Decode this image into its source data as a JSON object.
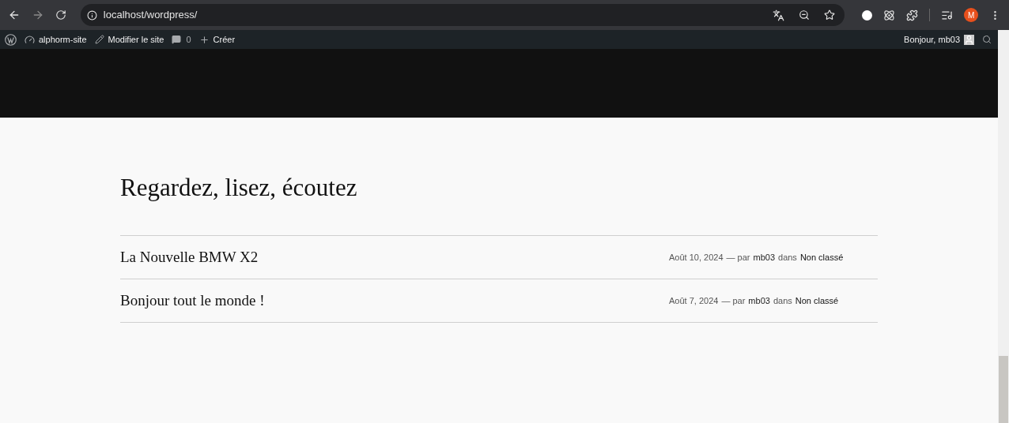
{
  "browser": {
    "url": "localhost/wordpress/",
    "profile_initial": "M"
  },
  "admin_bar": {
    "site": "alphorm-site",
    "edit": "Modifier le site",
    "comments": "0",
    "create": "Créer",
    "greeting": "Bonjour, mb03"
  },
  "section_title": "Regardez, lisez, écoutez",
  "posts": [
    {
      "title": "La Nouvelle BMW X2",
      "date": "Août 10, 2024",
      "by": "— par",
      "author": "mb03",
      "in": "dans",
      "category": "Non classé"
    },
    {
      "title": "Bonjour tout le monde !",
      "date": "Août 7, 2024",
      "by": "— par",
      "author": "mb03",
      "in": "dans",
      "category": "Non classé"
    }
  ]
}
